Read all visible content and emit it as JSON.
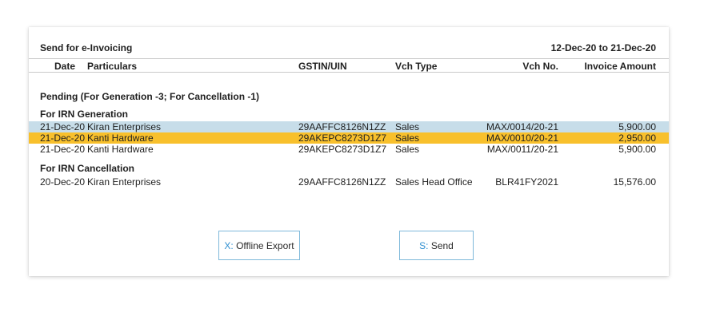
{
  "report": {
    "title": "Send for e-Invoicing",
    "date_range": "12-Dec-20 to 21-Dec-20"
  },
  "columns": {
    "date": "Date",
    "particulars": "Particulars",
    "gstin": "GSTIN/UIN",
    "vch_type": "Vch Type",
    "vch_no": "Vch No.",
    "amount": "Invoice Amount"
  },
  "pending_heading": "Pending (For Generation -3; For Cancellation -1)",
  "generation": {
    "heading": "For IRN Generation",
    "rows": [
      {
        "date": "21-Dec-20",
        "party": "Kiran Enterprises",
        "gstin": "29AAFFC8126N1ZZ",
        "type": "Sales",
        "no": "MAX/0014/20-21",
        "amount": "5,900.00"
      },
      {
        "date": "21-Dec-20",
        "party": "Kanti Hardware",
        "gstin": "29AKEPC8273D1Z7",
        "type": "Sales",
        "no": "MAX/0010/20-21",
        "amount": "2,950.00"
      },
      {
        "date": "21-Dec-20",
        "party": "Kanti Hardware",
        "gstin": "29AKEPC8273D1Z7",
        "type": "Sales",
        "no": "MAX/0011/20-21",
        "amount": "5,900.00"
      }
    ]
  },
  "cancellation": {
    "heading": "For IRN Cancellation",
    "rows": [
      {
        "date": "20-Dec-20",
        "party": "Kiran Enterprises",
        "gstin": "29AAFFC8126N1ZZ",
        "type": "Sales Head Office",
        "no": "BLR41FY2021",
        "amount": "15,576.00"
      }
    ]
  },
  "buttons": {
    "offline_key": "X:",
    "offline_label": "Offline Export",
    "send_key": "S:",
    "send_label": "Send"
  },
  "colors": {
    "selected_row_blue": "#c7dde9",
    "highlight_row_orange": "#f8c02c",
    "button_border": "#7fb9da",
    "shortcut_key": "#2f8fd0"
  }
}
